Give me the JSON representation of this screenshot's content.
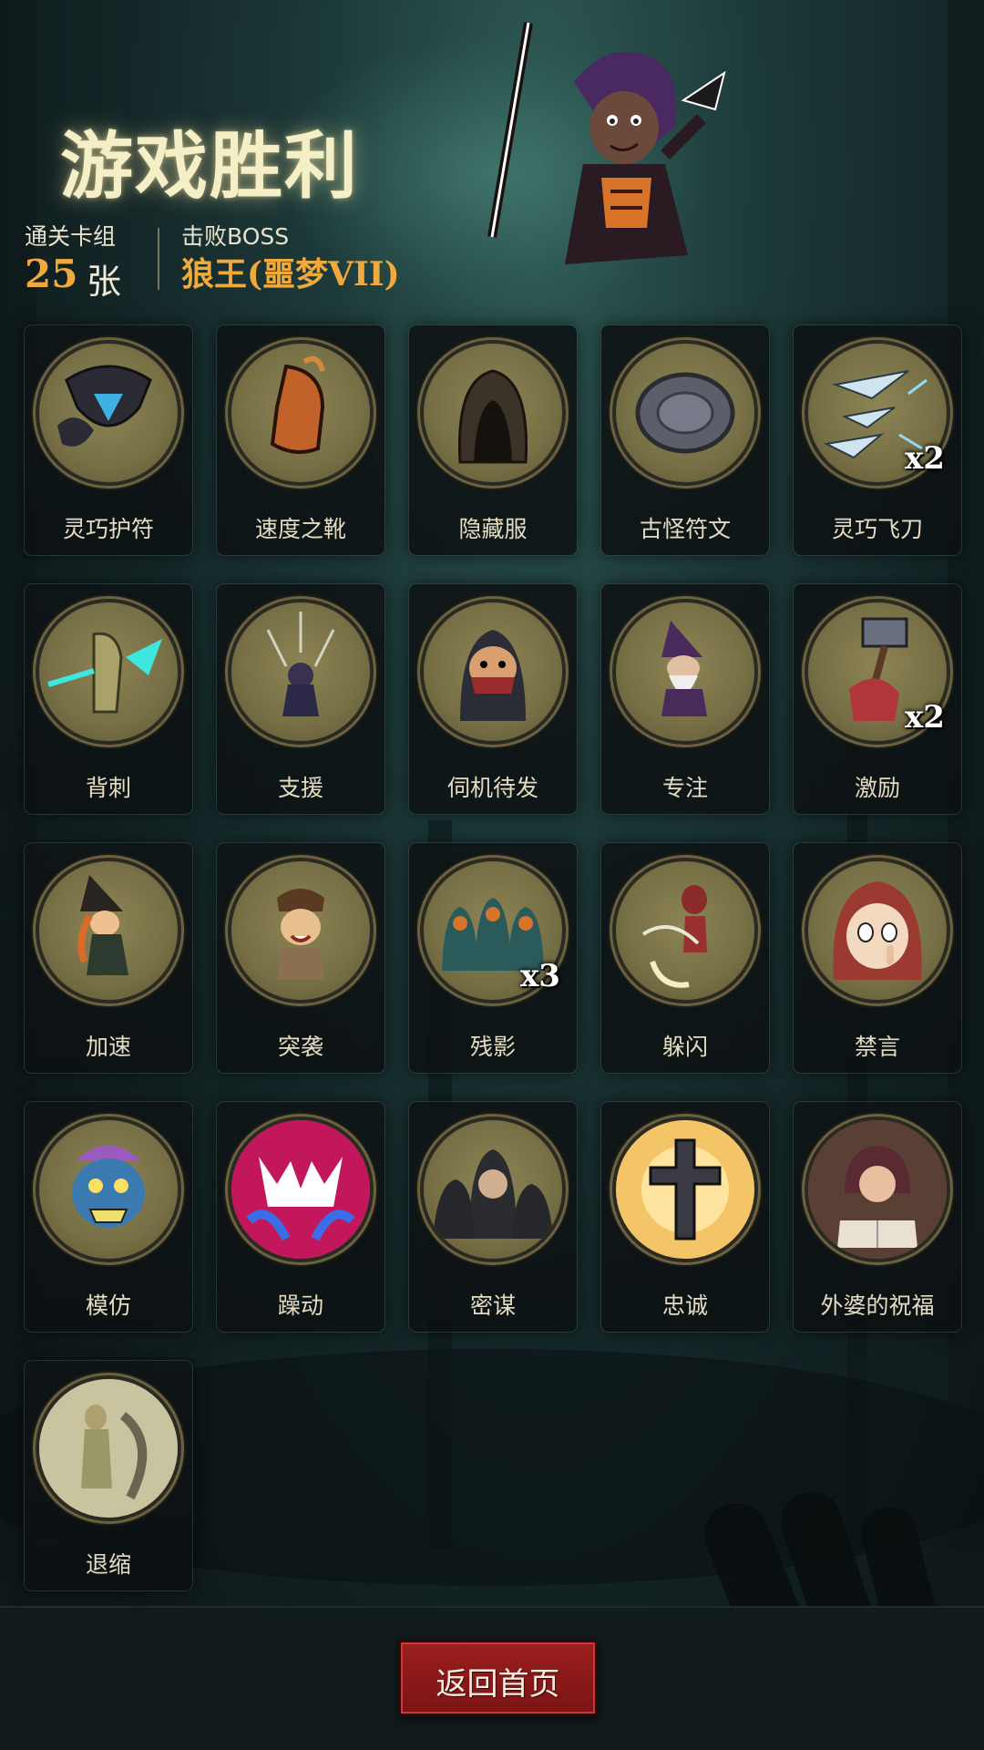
{
  "header": {
    "title": "游戏胜利",
    "deck_label": "通关卡组",
    "deck_count": "25",
    "deck_unit": "张",
    "boss_label": "击败BOSS",
    "boss_name": "狼王(噩梦VII)"
  },
  "cards": [
    {
      "label": "灵巧护符",
      "icon": "charm-icon",
      "count": ""
    },
    {
      "label": "速度之靴",
      "icon": "boot-icon",
      "count": ""
    },
    {
      "label": "隐藏服",
      "icon": "hood-icon",
      "count": ""
    },
    {
      "label": "古怪符文",
      "icon": "rune-icon",
      "count": ""
    },
    {
      "label": "灵巧飞刀",
      "icon": "daggers-icon",
      "count": "x2"
    },
    {
      "label": "背刺",
      "icon": "backstab-icon",
      "count": ""
    },
    {
      "label": "支援",
      "icon": "support-icon",
      "count": ""
    },
    {
      "label": "伺机待发",
      "icon": "assassin-icon",
      "count": ""
    },
    {
      "label": "专注",
      "icon": "wizard-icon",
      "count": ""
    },
    {
      "label": "激励",
      "icon": "hammer-icon",
      "count": "x2"
    },
    {
      "label": "加速",
      "icon": "witch-icon",
      "count": ""
    },
    {
      "label": "突袭",
      "icon": "raid-icon",
      "count": ""
    },
    {
      "label": "残影",
      "icon": "afterimage-icon",
      "count": "x3"
    },
    {
      "label": "躲闪",
      "icon": "dodge-icon",
      "count": ""
    },
    {
      "label": "禁言",
      "icon": "silence-icon",
      "count": ""
    },
    {
      "label": "模仿",
      "icon": "mimic-icon",
      "count": ""
    },
    {
      "label": "躁动",
      "icon": "frenzy-icon",
      "count": ""
    },
    {
      "label": "密谋",
      "icon": "conspiracy-icon",
      "count": ""
    },
    {
      "label": "忠诚",
      "icon": "cross-icon",
      "count": ""
    },
    {
      "label": "外婆的祝福",
      "icon": "grandma-icon",
      "count": ""
    },
    {
      "label": "退缩",
      "icon": "retreat-icon",
      "count": ""
    }
  ],
  "footer": {
    "home_label": "返回首页"
  },
  "colors": {
    "accent": "#f0a93d",
    "title": "#f5efc8",
    "button": "#8a1a1a"
  }
}
